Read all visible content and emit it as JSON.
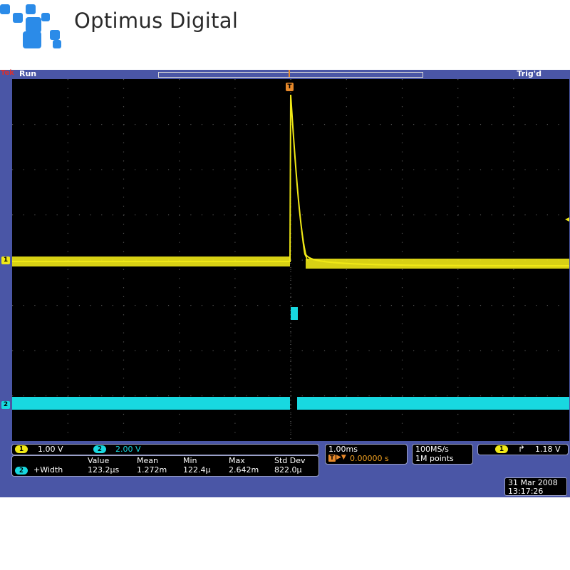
{
  "brand": {
    "logo_text": "Optimus Digital"
  },
  "scope": {
    "vendor": "Tek",
    "state": "Run",
    "trigger_status": "Trig'd",
    "date": "31 Mar 2008",
    "time": "13:17:26",
    "channels": [
      {
        "id": "1",
        "scale": "1.00 V",
        "color": "#f0e816"
      },
      {
        "id": "2",
        "scale": "2.00 V",
        "color": "#18d8e0"
      }
    ],
    "horizontal": {
      "time_div": "1.00ms",
      "delay": "0.00000 s"
    },
    "acquisition": {
      "rate": "100MS/s",
      "record": "1M points"
    },
    "trigger": {
      "channel": "1",
      "slope_icon": "rising-edge-icon",
      "level": "1.18 V"
    },
    "measurement": {
      "channel": "2",
      "name": "+Width",
      "headers": [
        "Value",
        "Mean",
        "Min",
        "Max",
        "Std Dev"
      ],
      "values": [
        "123.2µs",
        "1.272m",
        "122.4µ",
        "2.642m",
        "822.0µ"
      ]
    },
    "markers": {
      "trigger_pos": "T"
    },
    "colors": {
      "frame": "#4a56a6",
      "grid": "#555555",
      "ch1": "#f0e816",
      "ch2": "#18d8e0",
      "trigger": "#e8892a"
    }
  }
}
